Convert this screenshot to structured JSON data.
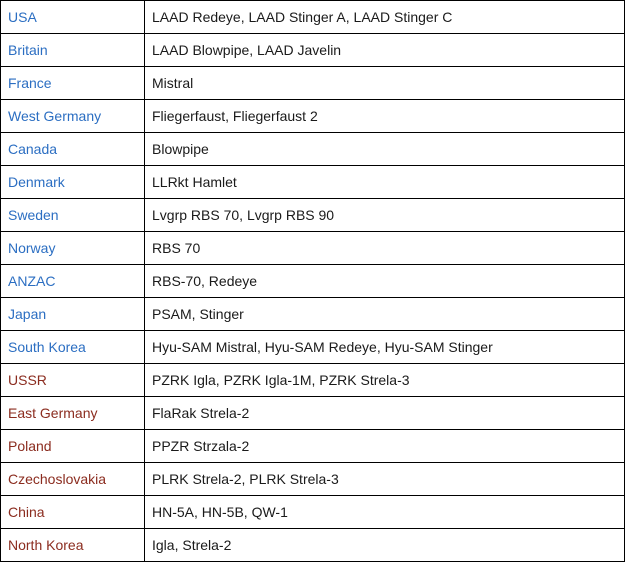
{
  "colors": {
    "western": "#2b6ec2",
    "eastern": "#8b2c1f",
    "text": "#1a1a1a"
  },
  "rows": [
    {
      "country": "USA",
      "bloc": "western",
      "systems": "LAAD Redeye, LAAD Stinger A, LAAD Stinger C"
    },
    {
      "country": "Britain",
      "bloc": "western",
      "systems": "LAAD Blowpipe, LAAD Javelin"
    },
    {
      "country": "France",
      "bloc": "western",
      "systems": "Mistral"
    },
    {
      "country": "West Germany",
      "bloc": "western",
      "systems": "Fliegerfaust, Fliegerfaust 2"
    },
    {
      "country": "Canada",
      "bloc": "western",
      "systems": "Blowpipe"
    },
    {
      "country": "Denmark",
      "bloc": "western",
      "systems": "LLRkt Hamlet"
    },
    {
      "country": "Sweden",
      "bloc": "western",
      "systems": "Lvgrp RBS 70, Lvgrp RBS 90"
    },
    {
      "country": "Norway",
      "bloc": "western",
      "systems": "RBS 70"
    },
    {
      "country": "ANZAC",
      "bloc": "western",
      "systems": "RBS-70, Redeye"
    },
    {
      "country": "Japan",
      "bloc": "western",
      "systems": "PSAM, Stinger"
    },
    {
      "country": "South Korea",
      "bloc": "western",
      "systems": "Hyu-SAM Mistral, Hyu-SAM Redeye, Hyu-SAM Stinger"
    },
    {
      "country": "USSR",
      "bloc": "eastern",
      "systems": "PZRK Igla, PZRK Igla-1M, PZRK Strela-3"
    },
    {
      "country": "East Germany",
      "bloc": "eastern",
      "systems": "FlaRak Strela-2"
    },
    {
      "country": "Poland",
      "bloc": "eastern",
      "systems": "PPZR Strzala-2"
    },
    {
      "country": "Czechoslovakia",
      "bloc": "eastern",
      "systems": "PLRK Strela-2, PLRK Strela-3"
    },
    {
      "country": "China",
      "bloc": "eastern",
      "systems": "HN-5A, HN-5B, QW-1"
    },
    {
      "country": "North Korea",
      "bloc": "eastern",
      "systems": "Igla, Strela-2"
    }
  ]
}
